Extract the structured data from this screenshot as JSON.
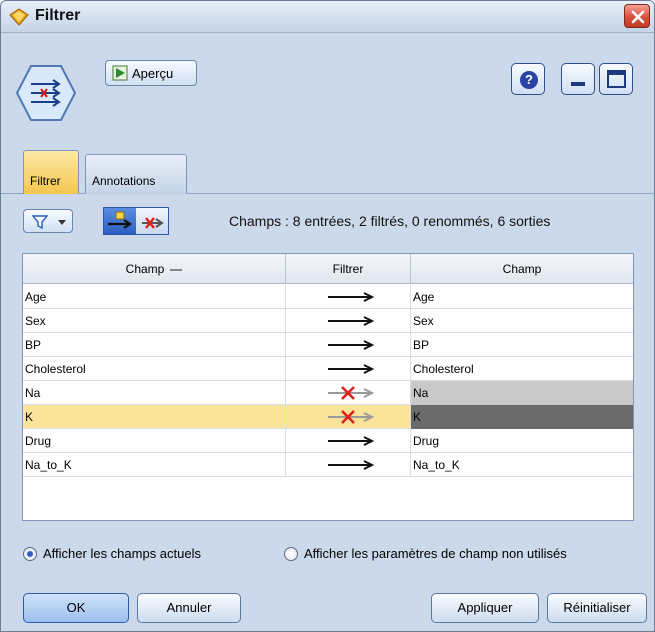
{
  "window": {
    "title": "Filtrer",
    "close_icon": "close-x-icon"
  },
  "header": {
    "preview_label": "Aperçu",
    "help_glyph": "?",
    "node_icon": "filter-node-icon"
  },
  "tabs": [
    {
      "label": "Filtrer",
      "selected": true
    },
    {
      "label": "Annotations",
      "selected": false
    }
  ],
  "toolbar": {
    "fields_summary": "Champs : 8 entrées, 2 filtrés, 0 renommés, 6 sorties"
  },
  "table": {
    "columns": [
      "Champ",
      "Filtrer",
      "Champ"
    ],
    "rows": [
      {
        "input": "Age",
        "filtered": false,
        "output": "Age"
      },
      {
        "input": "Sex",
        "filtered": false,
        "output": "Sex"
      },
      {
        "input": "BP",
        "filtered": false,
        "output": "BP"
      },
      {
        "input": "Cholesterol",
        "filtered": false,
        "output": "Cholesterol"
      },
      {
        "input": "Na",
        "filtered": true,
        "output": "Na"
      },
      {
        "input": "K",
        "filtered": true,
        "output": "K",
        "selected": true
      },
      {
        "input": "Drug",
        "filtered": false,
        "output": "Drug"
      },
      {
        "input": "Na_to_K",
        "filtered": false,
        "output": "Na_to_K"
      }
    ]
  },
  "radios": {
    "current": "Afficher les champs actuels",
    "unused": "Afficher les paramètres de champ non utilisés",
    "selected": "current"
  },
  "buttons": {
    "ok": "OK",
    "cancel": "Annuler",
    "apply": "Appliquer",
    "reset": "Réinitialiser"
  },
  "colors": {
    "selected_row": "#fbe49a",
    "active_tab": "#f4c64f",
    "filtered_x": "#e0201a"
  }
}
